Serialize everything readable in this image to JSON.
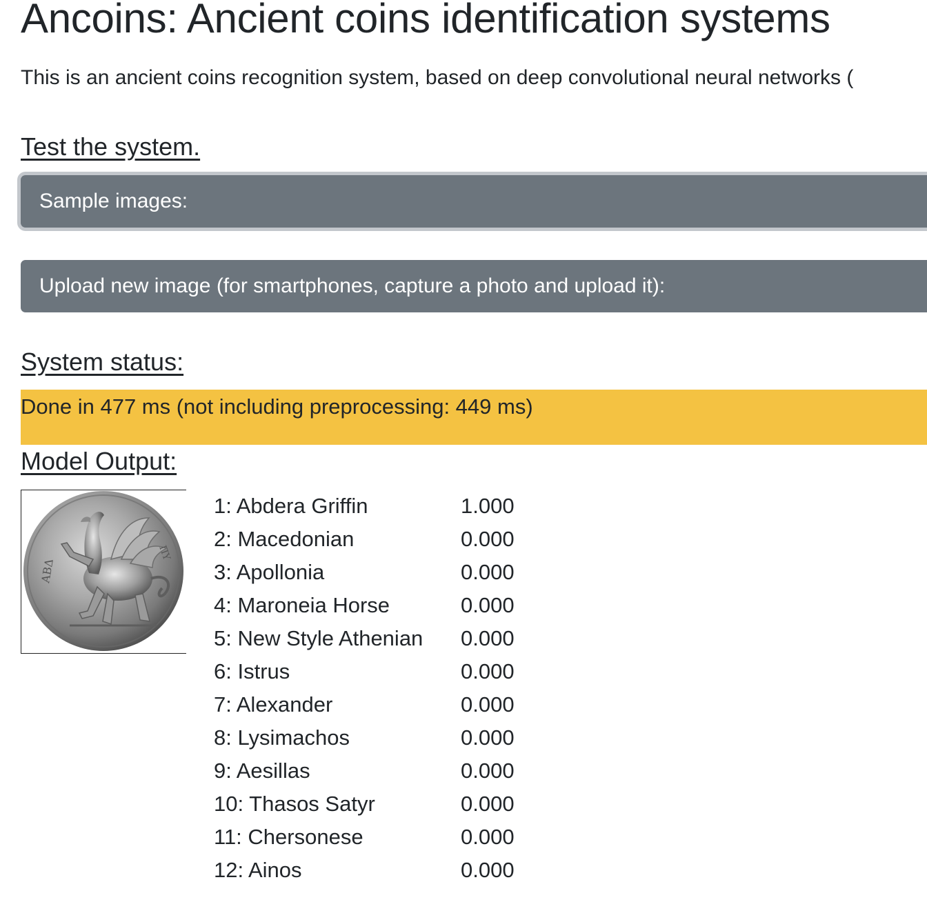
{
  "page": {
    "title": "Ancoins: Ancient coins identification systems",
    "intro": "This is an ancient coins recognition system, based on deep convolutional neural networks ("
  },
  "test_section": {
    "heading": "Test the system.",
    "sample_button_label": "Sample images:",
    "upload_button_label": "Upload new image (for smartphones, capture a photo and upload it):"
  },
  "status_section": {
    "heading": "System status:",
    "status_text": "Done in 477 ms (not including preprocessing: 449 ms)",
    "status_color": "#f4c242"
  },
  "output_section": {
    "heading": "Model Output:",
    "coin_image": "coin-griffin-image",
    "results": [
      {
        "label": "1: Abdera Griffin",
        "score": "1.000"
      },
      {
        "label": "2: Macedonian",
        "score": "0.000"
      },
      {
        "label": "3: Apollonia",
        "score": "0.000"
      },
      {
        "label": "4: Maroneia Horse",
        "score": "0.000"
      },
      {
        "label": "5: New Style Athenian",
        "score": "0.000"
      },
      {
        "label": "6: Istrus",
        "score": "0.000"
      },
      {
        "label": "7: Alexander",
        "score": "0.000"
      },
      {
        "label": "8: Lysimachos",
        "score": "0.000"
      },
      {
        "label": "9: Aesillas",
        "score": "0.000"
      },
      {
        "label": "10: Thasos Satyr",
        "score": "0.000"
      },
      {
        "label": "11: Chersonese",
        "score": "0.000"
      },
      {
        "label": "12: Ainos",
        "score": "0.000"
      }
    ]
  },
  "colors": {
    "button_bg": "#6c757d",
    "button_text": "#ffffff",
    "text": "#212529"
  }
}
